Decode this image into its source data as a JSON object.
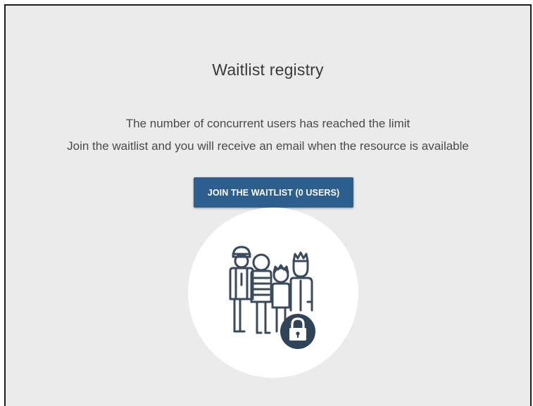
{
  "page": {
    "title": "Waitlist registry",
    "message_line1": "The number of concurrent users has reached the limit",
    "message_line2": "Join the waitlist and you will receive an email when the resource is available"
  },
  "actions": {
    "join_label": "JOIN THE WAITLIST (0 USERS)"
  },
  "illustration": {
    "icon": "waiting-people-lock-icon",
    "line_color": "#3a4a5e",
    "badge_color": "#2f4459",
    "circle_color": "#ffffff"
  },
  "colors": {
    "background": "#ebebeb",
    "button": "#2d5f8e",
    "text": "#3a3a3a"
  }
}
